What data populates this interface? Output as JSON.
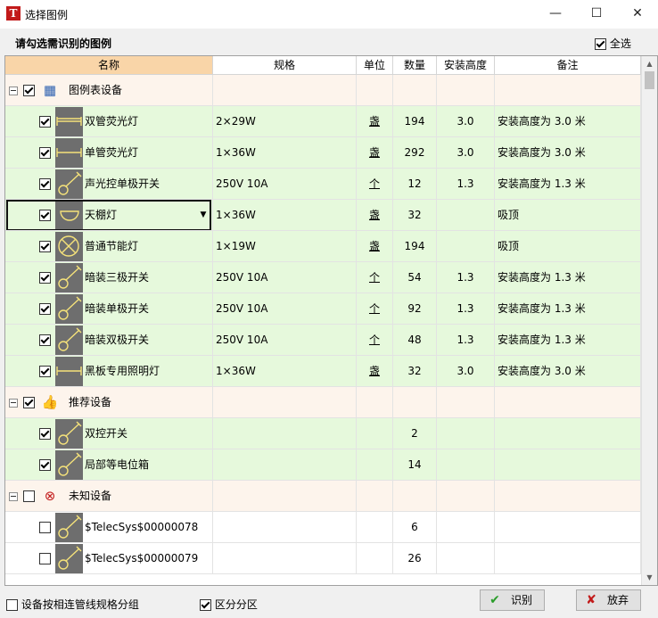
{
  "window": {
    "app_icon": "T",
    "title": "选择图例",
    "controls": {
      "minimize": "—",
      "maximize": "☐",
      "close": "✕"
    }
  },
  "subtitle": "请勾选需识别的图例",
  "select_all_label": "全选",
  "columns": [
    "名称",
    "规格",
    "单位",
    "数量",
    "安装高度",
    "备注"
  ],
  "groups": [
    {
      "label": "图例表设备",
      "icon": "legend-table-icon",
      "checked": true,
      "items": [
        {
          "name": "双管荧光灯",
          "spec": "2×29W",
          "unit": "盏",
          "qty": "194",
          "height": "3.0",
          "note": "安装高度为  3.0 米",
          "icon": "double-tube-lamp-icon",
          "checked": true
        },
        {
          "name": "单管荧光灯",
          "spec": "1×36W",
          "unit": "盏",
          "qty": "292",
          "height": "3.0",
          "note": "安装高度为  3.0 米",
          "icon": "single-tube-lamp-icon",
          "checked": true
        },
        {
          "name": "声光控单极开关",
          "spec": "250V 10A",
          "unit": "个",
          "qty": "12",
          "height": "1.3",
          "note": "安装高度为 1.3 米",
          "icon": "sound-light-switch-icon",
          "checked": true
        },
        {
          "name": "天棚灯",
          "spec": "1×36W",
          "unit": "盏",
          "qty": "32",
          "height": "",
          "note": "吸顶",
          "icon": "ceiling-lamp-icon",
          "checked": true
        },
        {
          "name": "普通节能灯",
          "spec": "1×19W",
          "unit": "盏",
          "qty": "194",
          "height": "",
          "note": "吸顶",
          "icon": "energy-saving-lamp-icon",
          "checked": true
        },
        {
          "name": "暗装三极开关",
          "spec": "250V 10A",
          "unit": "个",
          "qty": "54",
          "height": "1.3",
          "note": "安装高度为 1.3 米",
          "icon": "three-pole-switch-icon",
          "checked": true
        },
        {
          "name": "暗装单极开关",
          "spec": "250V 10A",
          "unit": "个",
          "qty": "92",
          "height": "1.3",
          "note": "安装高度为 1.3 米",
          "icon": "single-pole-switch-icon",
          "checked": true
        },
        {
          "name": "暗装双极开关",
          "spec": "250V 10A",
          "unit": "个",
          "qty": "48",
          "height": "1.3",
          "note": "安装高度为 1.3 米",
          "icon": "double-pole-switch-icon",
          "checked": true
        },
        {
          "name": "黑板专用照明灯",
          "spec": "1×36W",
          "unit": "盏",
          "qty": "32",
          "height": "3.0",
          "note": "安装高度为  3.0 米",
          "icon": "blackboard-lamp-icon",
          "checked": true
        }
      ]
    },
    {
      "label": "推荐设备",
      "icon": "thumbs-up-icon",
      "checked": true,
      "items": [
        {
          "name": "双控开关",
          "spec": "",
          "unit": "",
          "qty": "2",
          "height": "",
          "note": "",
          "icon": "two-way-switch-icon",
          "checked": true
        },
        {
          "name": "局部等电位箱",
          "spec": "",
          "unit": "",
          "qty": "14",
          "height": "",
          "note": "",
          "icon": "equipotential-box-icon",
          "checked": true
        }
      ]
    },
    {
      "label": "未知设备",
      "icon": "unknown-device-icon",
      "checked": false,
      "items": [
        {
          "name": "$TelecSys$00000078",
          "spec": "",
          "unit": "",
          "qty": "6",
          "height": "",
          "note": "",
          "icon": "unknown-symbol-icon",
          "checked": false
        },
        {
          "name": "$TelecSys$00000079",
          "spec": "",
          "unit": "",
          "qty": "26",
          "height": "",
          "note": "",
          "icon": "unknown-symbol-icon",
          "checked": false
        }
      ]
    }
  ],
  "bottom": {
    "option_group_by_spec": {
      "label": "设备按相连管线规格分组",
      "checked": false
    },
    "option_zone": {
      "label": "区分分区",
      "checked": true
    },
    "identify_button": "识别",
    "discard_button": "放弃"
  }
}
